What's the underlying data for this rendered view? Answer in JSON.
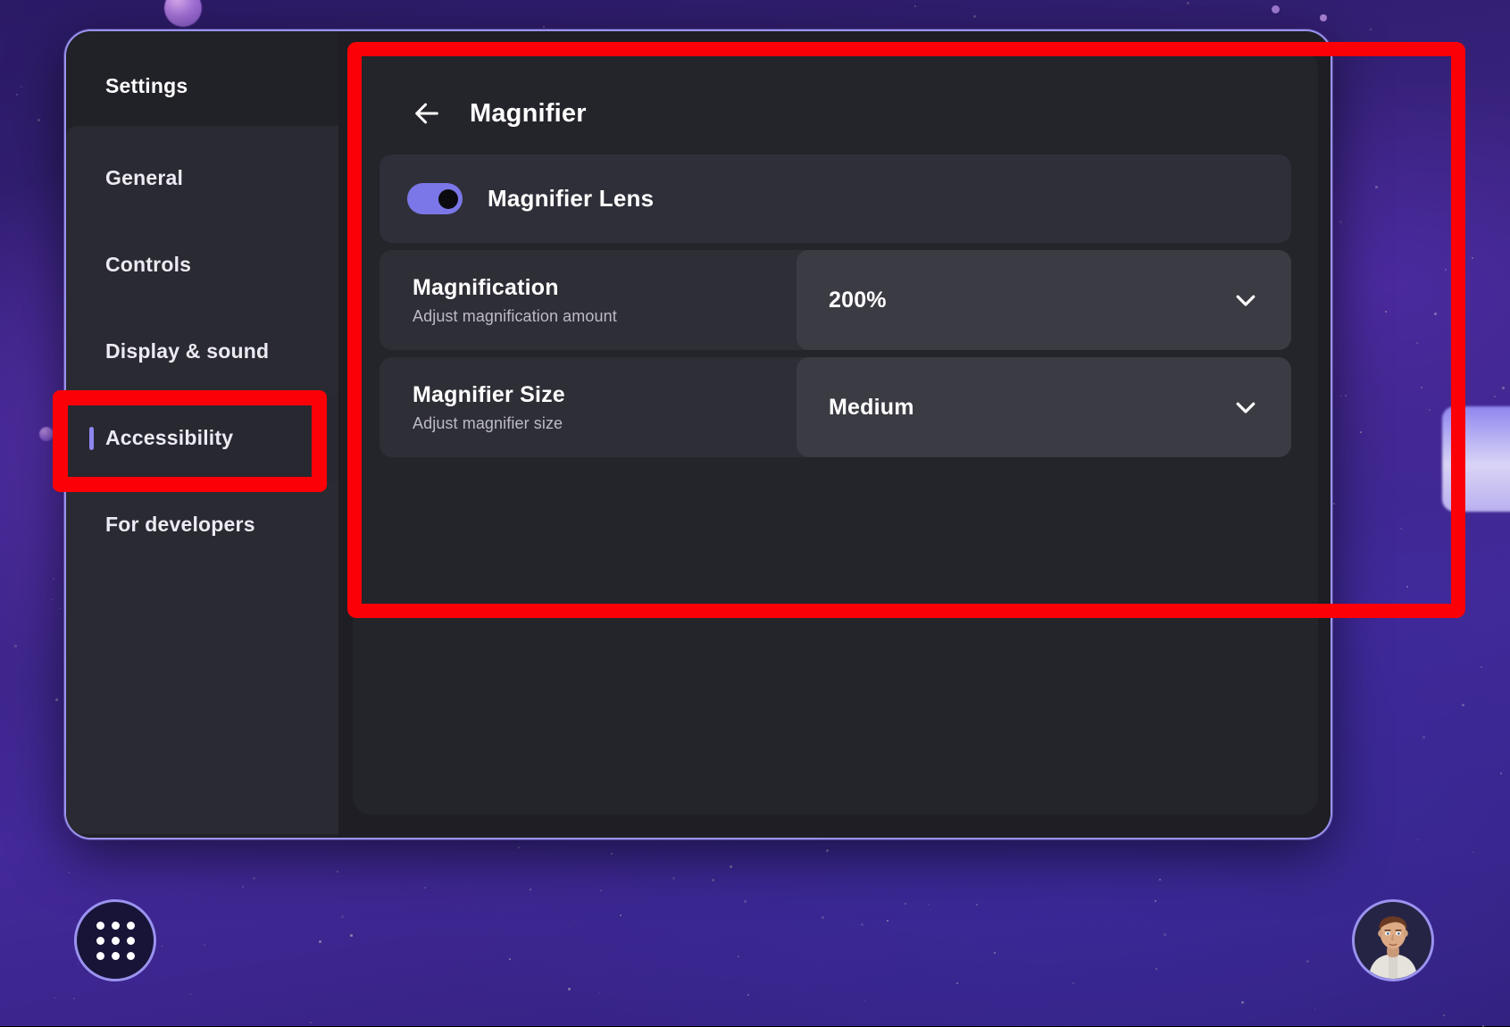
{
  "window": {
    "title": "Settings"
  },
  "sidebar": {
    "title": "Settings",
    "items": [
      {
        "label": "General",
        "active": false
      },
      {
        "label": "Controls",
        "active": false
      },
      {
        "label": "Display & sound",
        "active": false
      },
      {
        "label": "Accessibility",
        "active": true
      },
      {
        "label": "For developers",
        "active": false
      }
    ]
  },
  "page": {
    "back_icon": "back-arrow-icon",
    "title": "Magnifier",
    "toggle_row": {
      "label": "Magnifier Lens",
      "state": "on"
    },
    "rows": [
      {
        "title": "Magnification",
        "subtitle": "Adjust magnification amount",
        "value": "200%",
        "icon": "chevron-down-icon"
      },
      {
        "title": "Magnifier Size",
        "subtitle": "Adjust magnifier size",
        "value": "Medium",
        "icon": "chevron-down-icon"
      }
    ]
  },
  "taskbar": {
    "apps_button": "apps-grid-icon",
    "avatar": "user-avatar"
  },
  "annotations": [
    {
      "name": "panel-highlight",
      "color": "#fb0007"
    },
    {
      "name": "accessibility-highlight",
      "color": "#fb0007"
    }
  ],
  "colors": {
    "accent": "#8d86f0",
    "toggle_on": "#7b77e8",
    "annotation": "#fb0007",
    "window_border": "#9a93ef",
    "panel_bg": "#24242b",
    "row_bg": "#2e2e36",
    "row_value_bg": "#3b3b43"
  }
}
